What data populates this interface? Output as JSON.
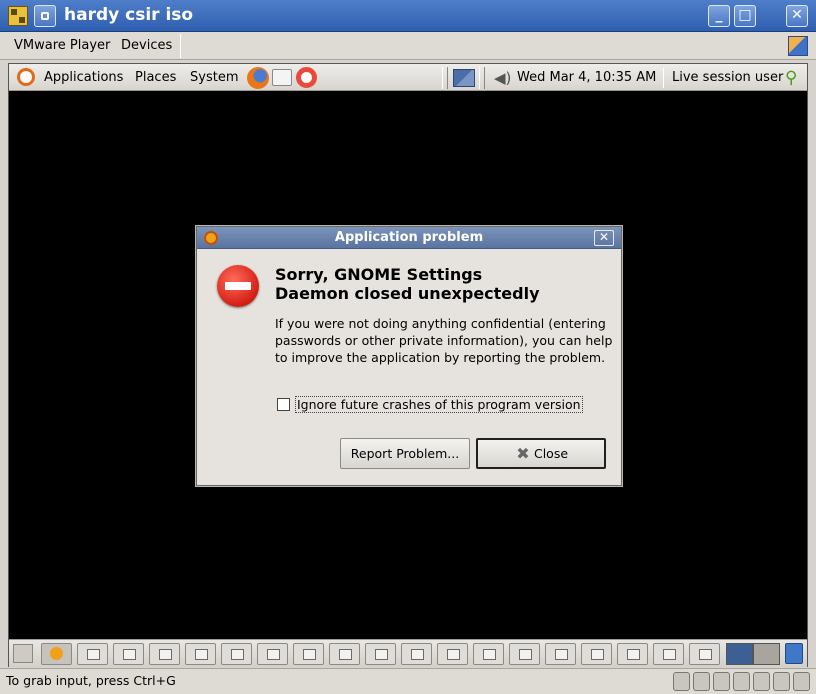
{
  "window": {
    "title": "hardy csir iso"
  },
  "vm_menu": {
    "items": [
      "VMware Player",
      "Devices"
    ]
  },
  "gnome_panel": {
    "menus": [
      "Applications",
      "Places",
      "System"
    ],
    "clock": "Wed Mar  4, 10:35 AM",
    "user": "Live session user"
  },
  "dialog": {
    "title": "Application problem",
    "heading_line1": "Sorry, GNOME Settings",
    "heading_line2": "Daemon closed unexpectedly",
    "body": "If you were not doing anything confidential (entering passwords or other private information), you can help to improve the application by reporting the problem.",
    "checkbox_label": "Ignore future crashes of this program version",
    "checkbox_checked": false,
    "report_button": "Report Problem...",
    "close_button": "Close"
  },
  "status_bar": {
    "message": "To grab input, press Ctrl+G"
  },
  "colors": {
    "titlebar": "#3c6cbf",
    "dialog_title": "#6a84ae",
    "stop_icon": "#d31f14"
  }
}
